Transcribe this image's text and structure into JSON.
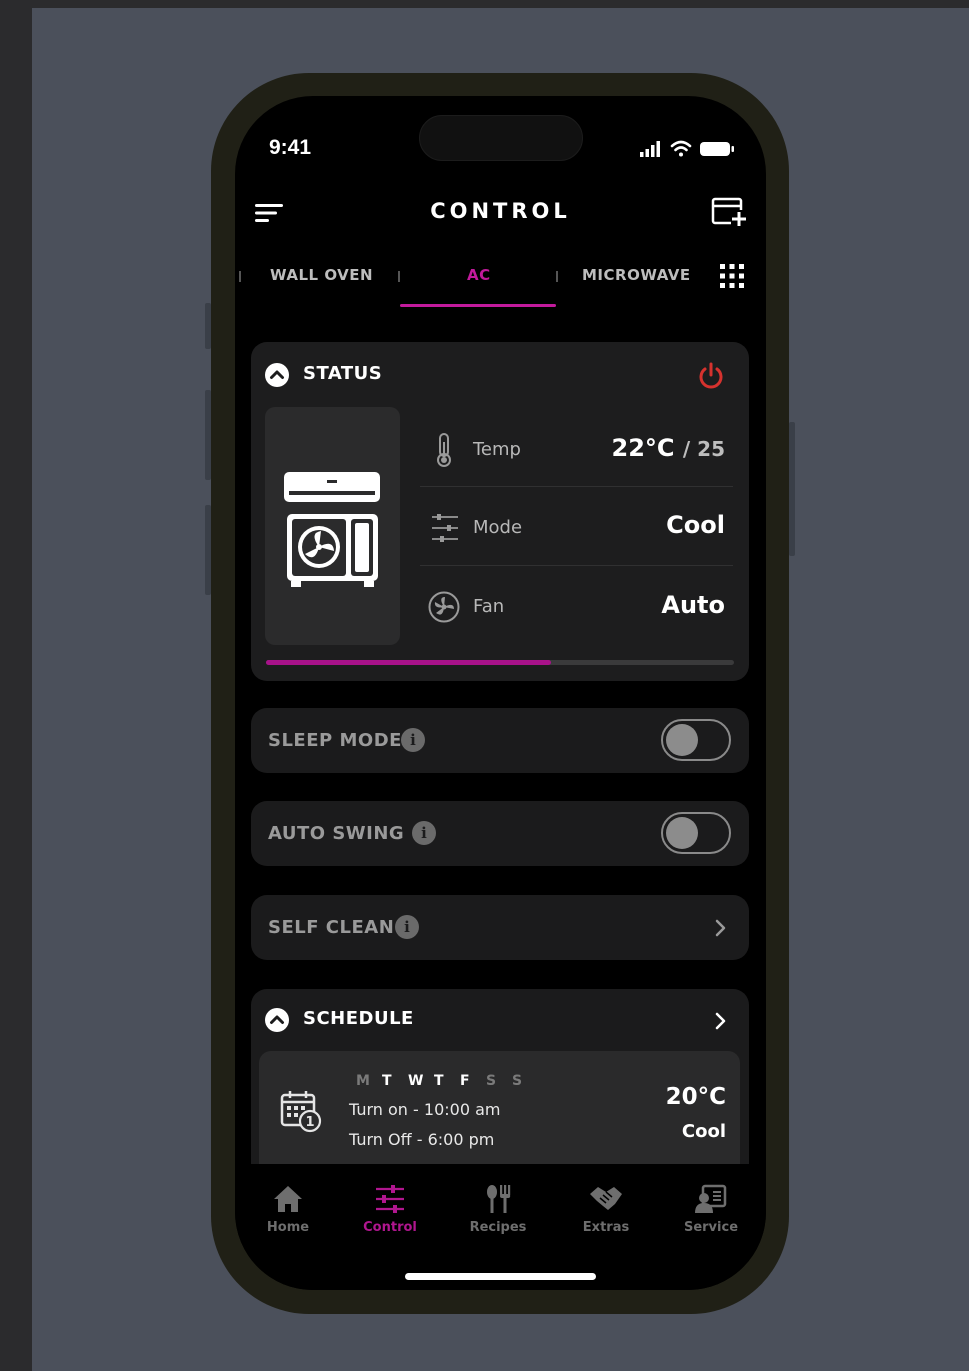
{
  "status_bar": {
    "time": "9:41"
  },
  "header": {
    "title": "CONTROL"
  },
  "tabs": [
    {
      "label": "WALL OVEN",
      "active": false
    },
    {
      "label": "AC",
      "active": true
    },
    {
      "label": "MICROWAVE",
      "active": false
    }
  ],
  "status": {
    "title": "STATUS",
    "rows": [
      {
        "label": "Temp",
        "value": "22°C",
        "target": "/ 25",
        "icon": "thermometer-icon"
      },
      {
        "label": "Mode",
        "value": "Cool",
        "icon": "sliders-icon"
      },
      {
        "label": "Fan",
        "value": "Auto",
        "icon": "fan-icon"
      }
    ],
    "progress": 0.61
  },
  "settings": {
    "sleep_mode": {
      "label": "SLEEP MODE",
      "on": false
    },
    "auto_swing": {
      "label": "AUTO SWING",
      "on": false
    },
    "self_clean": {
      "label": "SELF CLEAN"
    }
  },
  "info_glyph": "i",
  "schedule": {
    "title": "SCHEDULE",
    "days": [
      {
        "label": "M",
        "active": false
      },
      {
        "label": "T",
        "active": true
      },
      {
        "label": "W",
        "active": true
      },
      {
        "label": "T",
        "active": true
      },
      {
        "label": "F",
        "active": true
      },
      {
        "label": "S",
        "active": false
      },
      {
        "label": "S",
        "active": false
      }
    ],
    "turn_on": "Turn on - 10:00 am",
    "turn_off": "Turn Off - 6:00 pm",
    "temp": "20°C",
    "mode": "Cool"
  },
  "nav": [
    {
      "label": "Home",
      "icon": "home-icon",
      "active": false
    },
    {
      "label": "Control",
      "icon": "control-icon",
      "active": true
    },
    {
      "label": "Recipes",
      "icon": "recipes-icon",
      "active": false
    },
    {
      "label": "Extras",
      "icon": "extras-icon",
      "active": false
    },
    {
      "label": "Service",
      "icon": "service-icon",
      "active": false
    }
  ],
  "colors": {
    "accent": "#c21a9c",
    "power": "#d6322e",
    "card": "#1b1b1c"
  }
}
